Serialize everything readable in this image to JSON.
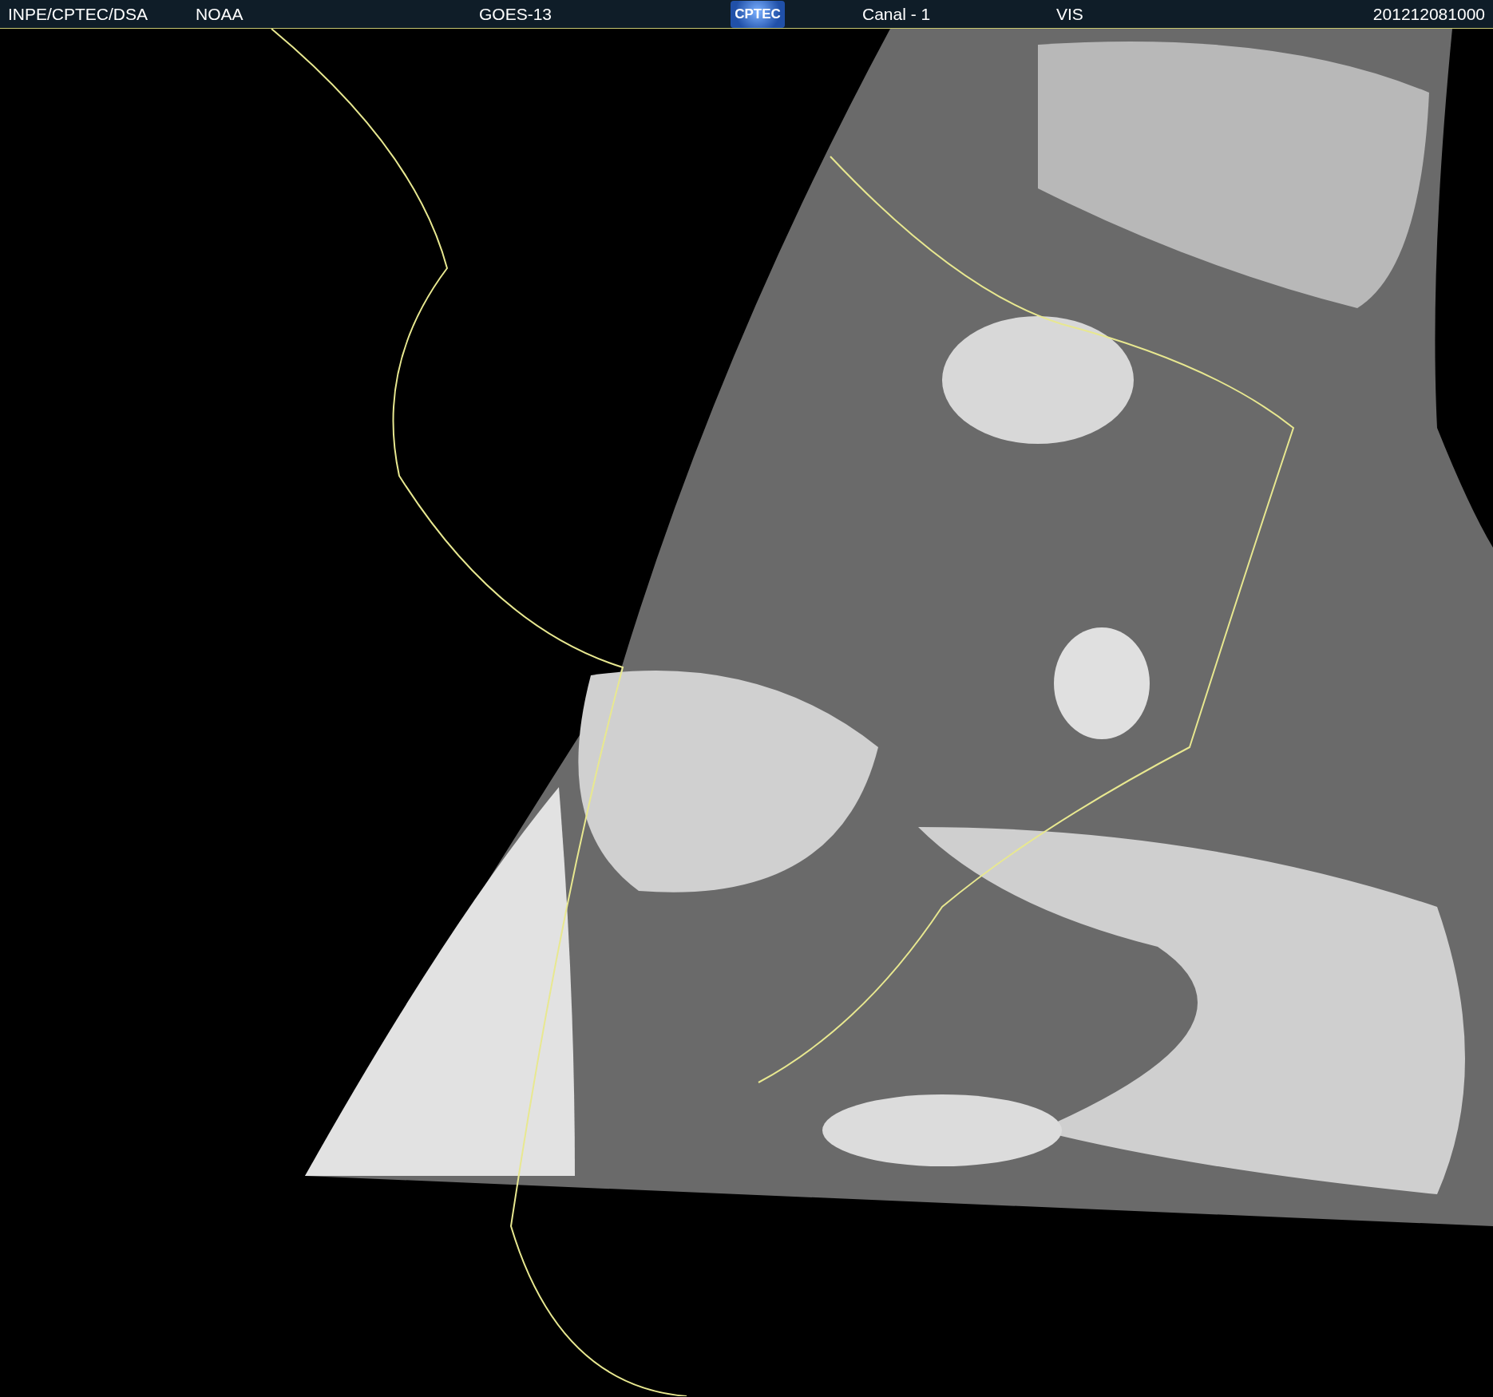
{
  "header": {
    "items": [
      {
        "kind": "text",
        "text": "INPE/CPTEC/DSA"
      },
      {
        "kind": "text",
        "text": "NOAA"
      },
      {
        "kind": "text",
        "text": "GOES-13"
      },
      {
        "kind": "logo",
        "text": "CPTEC"
      },
      {
        "kind": "text",
        "text": "Canal - 1"
      },
      {
        "kind": "text",
        "text": "VIS"
      },
      {
        "kind": "text",
        "text": "201212081000"
      }
    ]
  }
}
